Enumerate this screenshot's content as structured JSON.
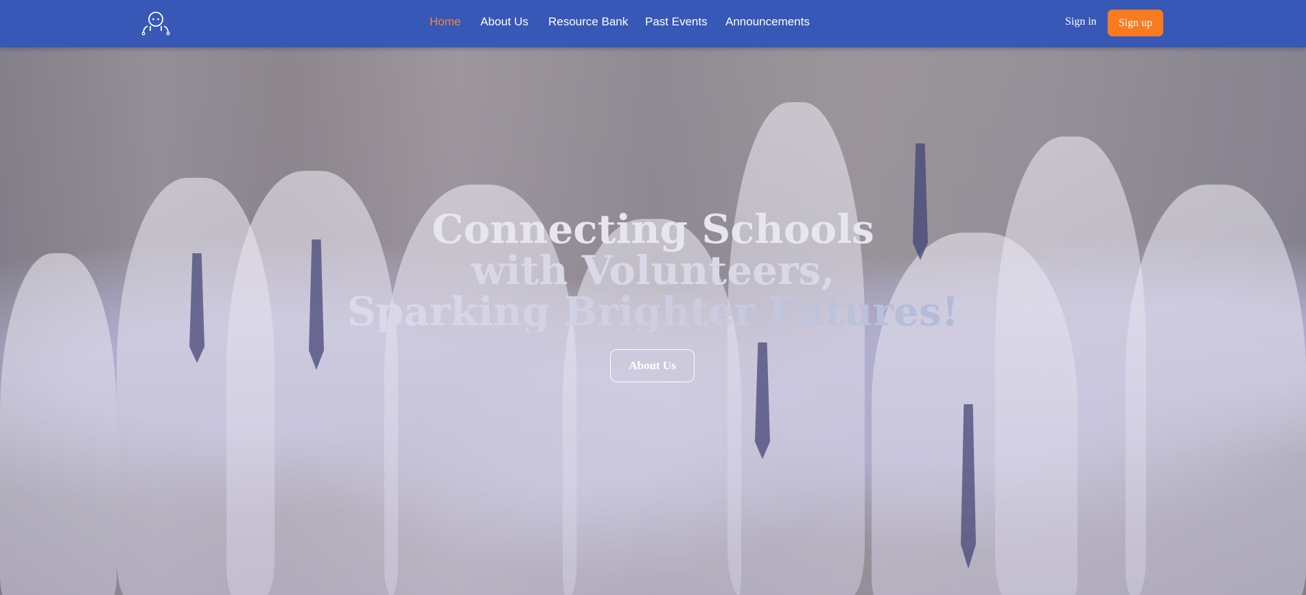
{
  "nav": {
    "logo_icon": "robot-head-icon",
    "links": [
      {
        "label": "Home",
        "active": true
      },
      {
        "label": "About Us",
        "active": false
      },
      {
        "label": "Resource Bank",
        "active": false
      },
      {
        "label": "Past Events",
        "active": false
      },
      {
        "label": "Announcements",
        "active": false
      }
    ],
    "signin_label": "Sign in",
    "signup_label": "Sign up"
  },
  "hero": {
    "headline_line1": "Connecting Schools",
    "headline_line2": "with Volunteers,",
    "headline_line3": "Sparking Brighter Futures!",
    "cta_label": "About Us"
  },
  "colors": {
    "navbar": "#3758b6",
    "active_link": "#f5843a",
    "signup_button": "#f97b1f"
  }
}
